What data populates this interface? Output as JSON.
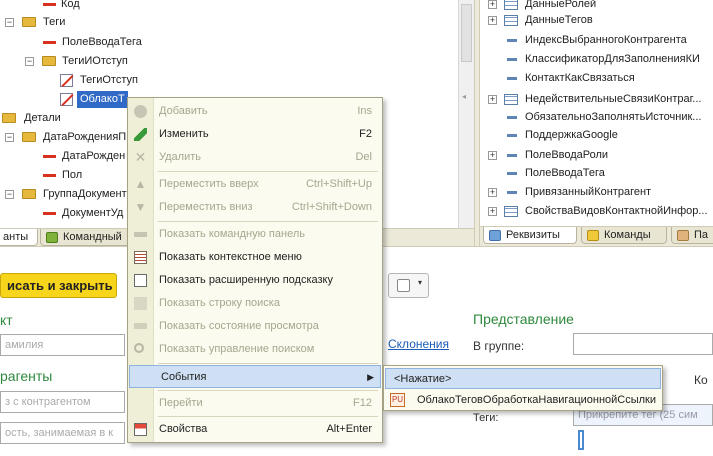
{
  "left_tree": {
    "items": [
      {
        "label": "Код",
        "icon": "attribute-icon"
      },
      {
        "label": "Теги",
        "icon": "folder-icon"
      },
      {
        "label": "ПолеВводаТега",
        "icon": "attribute-icon"
      },
      {
        "label": "ТегиИОтступ",
        "icon": "folder-icon"
      },
      {
        "label": "ТегиОтступ",
        "icon": "hidden-item-icon"
      },
      {
        "label": "ОблакоТ",
        "icon": "hidden-item-icon"
      },
      {
        "label": "Детали",
        "icon": "folder-icon"
      },
      {
        "label": "ДатаРожденияП",
        "icon": "folder-icon"
      },
      {
        "label": "ДатаРожден",
        "icon": "attribute-icon"
      },
      {
        "label": "Пол",
        "icon": "attribute-icon"
      },
      {
        "label": "ГруппаДокумент",
        "icon": "folder-icon"
      },
      {
        "label": "ДокументУд",
        "icon": "attribute-icon"
      }
    ]
  },
  "left_tabs": [
    {
      "label": "анты"
    },
    {
      "label": "Командный"
    }
  ],
  "right_tree": {
    "items": [
      {
        "label": "ДанныеРолей"
      },
      {
        "label": "ДанныеТегов"
      },
      {
        "label": "ИндексВыбранногоКонтрагента"
      },
      {
        "label": "КлассификаторДляЗаполненияКИ"
      },
      {
        "label": "КонтактКакСвязаться"
      },
      {
        "label": "НедействительныеСвязиКонтраг..."
      },
      {
        "label": "ОбязательноЗаполнятьИсточник..."
      },
      {
        "label": "ПоддержкаGoogle"
      },
      {
        "label": "ПолеВводаРоли"
      },
      {
        "label": "ПолеВводаТега"
      },
      {
        "label": "ПривязанныйКонтрагент"
      },
      {
        "label": "СвойстваВидовКонтактнойИнфор..."
      }
    ]
  },
  "right_tabs": [
    {
      "label": "Реквизиты"
    },
    {
      "label": "Команды"
    },
    {
      "label": "Па"
    }
  ],
  "form": {
    "save_button": "исать и закрыть",
    "section_left": "кт",
    "input_name_placeholder": "амилия",
    "declension_link": "Склонения",
    "section_counterparties": "рагенты",
    "input_contractors_placeholder": "з с контрагентом",
    "input_position_placeholder": "ость, занимаемая в к",
    "section_representation": "Представление",
    "group_label": "В группе:",
    "right_label_ko": "Ко",
    "tags_label": "Теги:",
    "tags_placeholder": "Прикрепите тег (25 сим"
  },
  "context_menu": {
    "items": [
      {
        "label": "Добавить",
        "shortcut": "Ins",
        "icon": "add-icon",
        "enabled": false
      },
      {
        "label": "Изменить",
        "shortcut": "F2",
        "icon": "edit-icon",
        "enabled": true
      },
      {
        "label": "Удалить",
        "shortcut": "Del",
        "icon": "delete-icon",
        "enabled": false
      },
      {
        "label": "Переместить вверх",
        "shortcut": "Ctrl+Shift+Up",
        "icon": "move-up-icon",
        "enabled": false
      },
      {
        "label": "Переместить вниз",
        "shortcut": "Ctrl+Shift+Down",
        "icon": "move-down-icon",
        "enabled": false
      },
      {
        "label": "Показать командную панель",
        "shortcut": "",
        "icon": "command-bar-icon",
        "enabled": false
      },
      {
        "label": "Показать контекстное меню",
        "shortcut": "",
        "icon": "context-menu-icon",
        "enabled": true
      },
      {
        "label": "Показать расширенную подсказку",
        "shortcut": "",
        "icon": "tooltip-icon",
        "enabled": true
      },
      {
        "label": "Показать строку поиска",
        "shortcut": "",
        "icon": "search-bar-icon",
        "enabled": false
      },
      {
        "label": "Показать состояние просмотра",
        "shortcut": "",
        "icon": "view-state-icon",
        "enabled": false
      },
      {
        "label": "Показать управление поиском",
        "shortcut": "",
        "icon": "search-control-icon",
        "enabled": false
      },
      {
        "label": "События",
        "shortcut": "",
        "icon": "",
        "enabled": true
      },
      {
        "label": "Перейти",
        "shortcut": "F12",
        "icon": "",
        "enabled": false
      },
      {
        "label": "Свойства",
        "shortcut": "Alt+Enter",
        "icon": "properties-icon",
        "enabled": true
      }
    ]
  },
  "submenu": {
    "items": [
      {
        "label": "<Нажатие>"
      },
      {
        "label": "ОблакоТеговОбработкаНавигационнойСсылки"
      }
    ]
  },
  "colors": {
    "accent_yellow": "#f7d51b",
    "menu_bg": "#fbfbef",
    "highlight": "#cfe0f4",
    "green_title": "#2f8a3e",
    "link": "#1b5cb5",
    "folder": "#e6b93d",
    "attr_red": "#d9311f"
  }
}
